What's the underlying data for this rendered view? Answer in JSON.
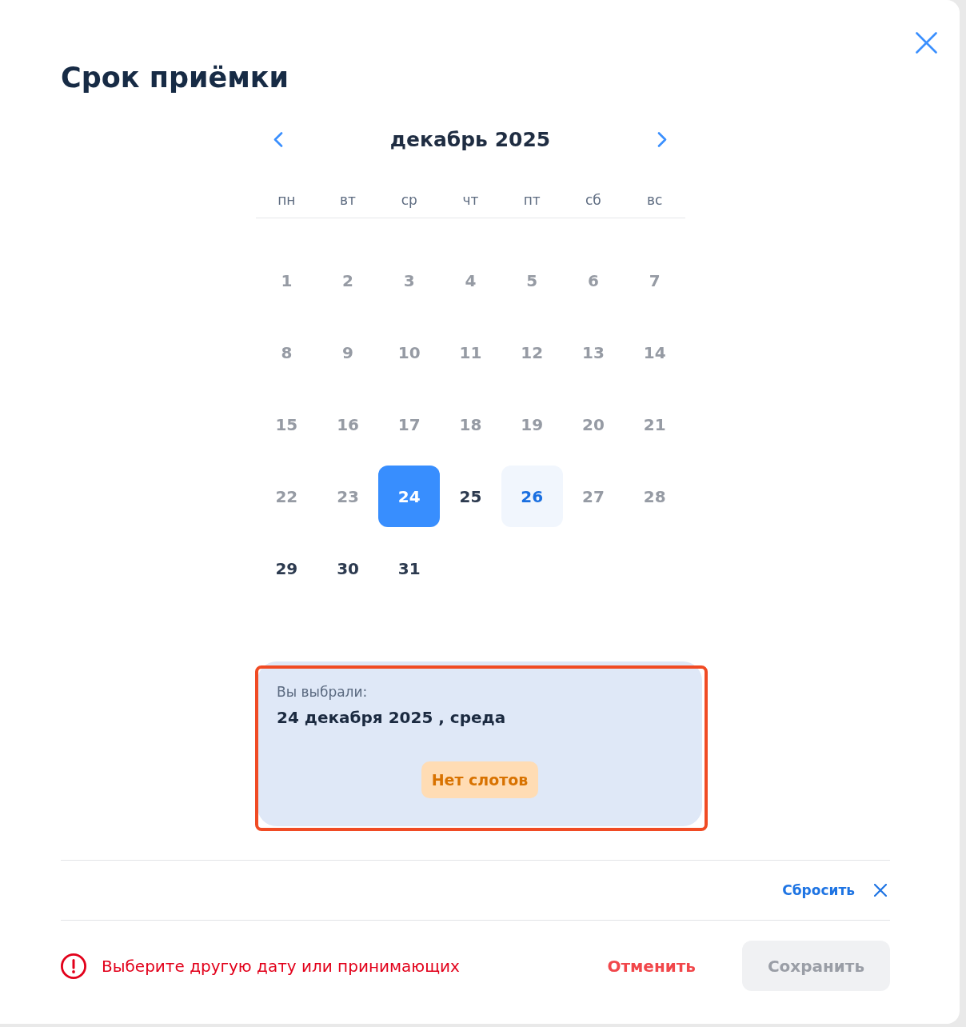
{
  "dialog": {
    "title": "Срок приёмки"
  },
  "calendar": {
    "month": "декабрь 2025",
    "weekdays": [
      "пн",
      "вт",
      "ср",
      "чт",
      "пт",
      "сб",
      "вс"
    ],
    "days": [
      {
        "label": "1",
        "disabled": true,
        "selected": false,
        "highlighted": false
      },
      {
        "label": "2",
        "disabled": true,
        "selected": false,
        "highlighted": false
      },
      {
        "label": "3",
        "disabled": true,
        "selected": false,
        "highlighted": false
      },
      {
        "label": "4",
        "disabled": true,
        "selected": false,
        "highlighted": false
      },
      {
        "label": "5",
        "disabled": true,
        "selected": false,
        "highlighted": false
      },
      {
        "label": "6",
        "disabled": true,
        "selected": false,
        "highlighted": false
      },
      {
        "label": "7",
        "disabled": true,
        "selected": false,
        "highlighted": false
      },
      {
        "label": "8",
        "disabled": true,
        "selected": false,
        "highlighted": false
      },
      {
        "label": "9",
        "disabled": true,
        "selected": false,
        "highlighted": false
      },
      {
        "label": "10",
        "disabled": true,
        "selected": false,
        "highlighted": false
      },
      {
        "label": "11",
        "disabled": true,
        "selected": false,
        "highlighted": false
      },
      {
        "label": "12",
        "disabled": true,
        "selected": false,
        "highlighted": false
      },
      {
        "label": "13",
        "disabled": true,
        "selected": false,
        "highlighted": false
      },
      {
        "label": "14",
        "disabled": true,
        "selected": false,
        "highlighted": false
      },
      {
        "label": "15",
        "disabled": true,
        "selected": false,
        "highlighted": false
      },
      {
        "label": "16",
        "disabled": true,
        "selected": false,
        "highlighted": false
      },
      {
        "label": "17",
        "disabled": true,
        "selected": false,
        "highlighted": false
      },
      {
        "label": "18",
        "disabled": true,
        "selected": false,
        "highlighted": false
      },
      {
        "label": "19",
        "disabled": true,
        "selected": false,
        "highlighted": false
      },
      {
        "label": "20",
        "disabled": true,
        "selected": false,
        "highlighted": false
      },
      {
        "label": "21",
        "disabled": true,
        "selected": false,
        "highlighted": false
      },
      {
        "label": "22",
        "disabled": true,
        "selected": false,
        "highlighted": false
      },
      {
        "label": "23",
        "disabled": true,
        "selected": false,
        "highlighted": false
      },
      {
        "label": "24",
        "disabled": false,
        "selected": true,
        "highlighted": false
      },
      {
        "label": "25",
        "disabled": false,
        "selected": false,
        "highlighted": false
      },
      {
        "label": "26",
        "disabled": false,
        "selected": false,
        "highlighted": true
      },
      {
        "label": "27",
        "disabled": true,
        "selected": false,
        "highlighted": false
      },
      {
        "label": "28",
        "disabled": true,
        "selected": false,
        "highlighted": false
      },
      {
        "label": "29",
        "disabled": false,
        "selected": false,
        "highlighted": false
      },
      {
        "label": "30",
        "disabled": false,
        "selected": false,
        "highlighted": false
      },
      {
        "label": "31",
        "disabled": false,
        "selected": false,
        "highlighted": false
      }
    ]
  },
  "summary": {
    "caption": "Вы выбрали:",
    "date": "24 декабря 2025 , среда",
    "status": "Нет слотов",
    "highlighted": true
  },
  "reset": {
    "label": "Сбросить"
  },
  "footer": {
    "error": "Выберите другую дату или принимающих",
    "cancel": "Отменить",
    "save": {
      "label": "Сохранить",
      "disabled": true
    }
  }
}
